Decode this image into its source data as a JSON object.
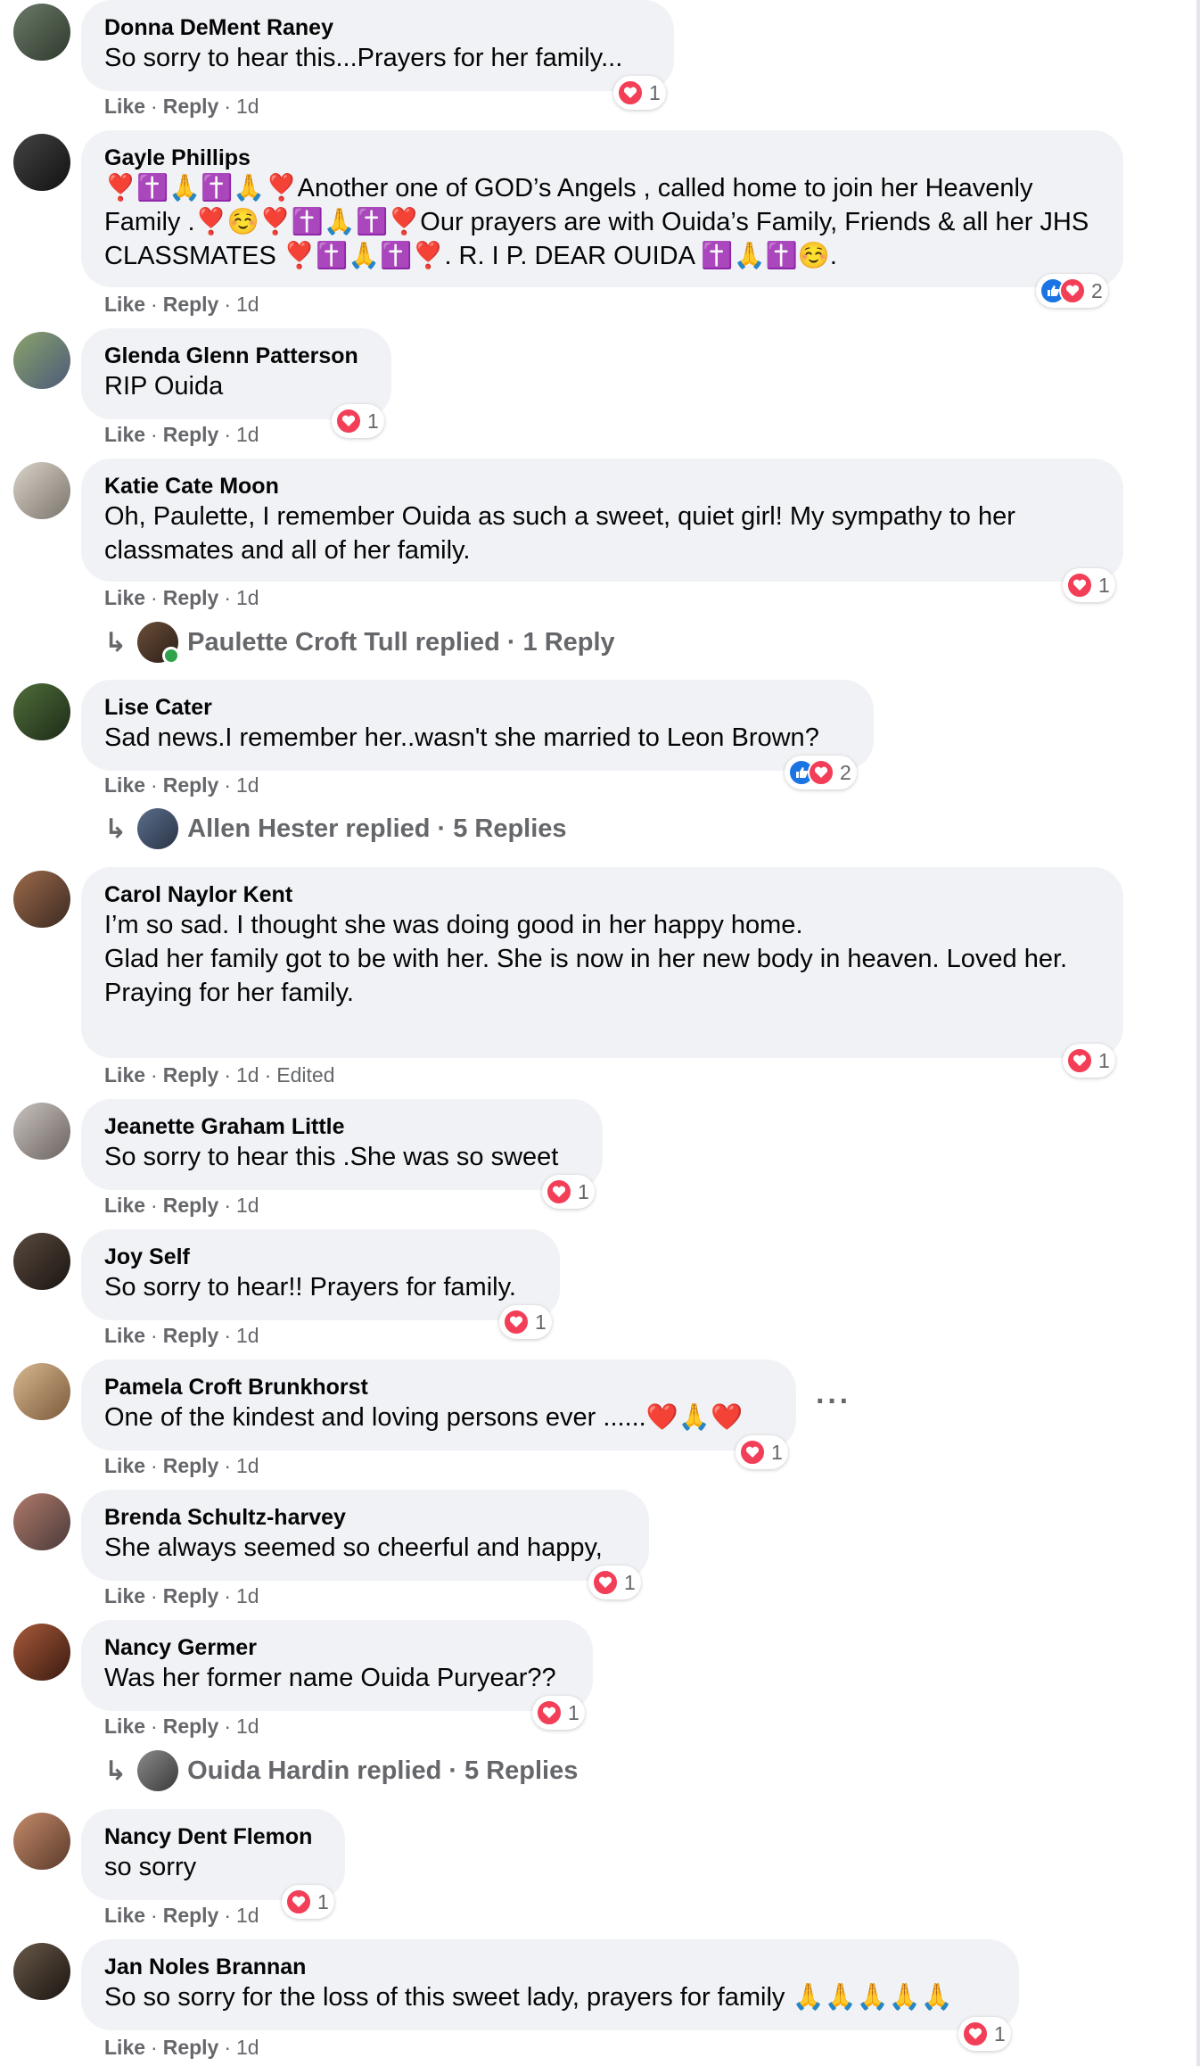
{
  "comments": [
    {
      "author": "Donna DeMent Raney",
      "text": "So sorry to hear this...Prayers for her family...",
      "like": "Like",
      "reply": "Reply",
      "time": "1d",
      "edited": "",
      "reactions": "1"
    },
    {
      "author": "Gayle Phillips",
      "text": "❣️✝️🙏✝️🙏❣️Another one of GOD’s Angels , called home to join her Heavenly Family .❣️☺️❣️✝️🙏✝️❣️Our prayers are with Ouida’s Family, Friends & all her JHS CLASSMATES ❣️✝️🙏✝️❣️. R. I P. DEAR OUIDA ✝️🙏✝️☺️.",
      "like": "Like",
      "reply": "Reply",
      "time": "1d",
      "edited": "",
      "reactions": "2"
    },
    {
      "author": "Glenda Glenn Patterson",
      "text": "RIP Ouida",
      "like": "Like",
      "reply": "Reply",
      "time": "1d",
      "edited": "",
      "reactions": "1"
    },
    {
      "author": "Katie Cate Moon",
      "text": "Oh, Paulette, I remember Ouida as such a sweet, quiet girl! My sympathy to her classmates and all of her family.",
      "like": "Like",
      "reply": "Reply",
      "time": "1d",
      "edited": "",
      "reactions": "1",
      "replied_by": "Paulette Croft Tull replied",
      "reply_count": "1 Reply"
    },
    {
      "author": "Lise Cater",
      "text": "Sad news.I remember her..wasn't she married to Leon Brown?",
      "like": "Like",
      "reply": "Reply",
      "time": "1d",
      "edited": "",
      "reactions": "2",
      "replied_by": "Allen Hester replied",
      "reply_count": "5 Replies"
    },
    {
      "author": "Carol Naylor Kent",
      "text": "I’m so sad. I thought she was doing good in her happy home.\nGlad her family got to be with her. She is now in her new body in heaven. Loved her.\nPraying for her family.",
      "like": "Like",
      "reply": "Reply",
      "time": "1d",
      "edited": "Edited",
      "reactions": "1"
    },
    {
      "author": "Jeanette Graham Little",
      "text": "So sorry to hear this .She was so sweet",
      "like": "Like",
      "reply": "Reply",
      "time": "1d",
      "edited": "",
      "reactions": "1"
    },
    {
      "author": "Joy Self",
      "text": "So sorry to hear!! Prayers for family.",
      "like": "Like",
      "reply": "Reply",
      "time": "1d",
      "edited": "",
      "reactions": "1"
    },
    {
      "author": "Pamela Croft Brunkhorst",
      "text": "One of the kindest and loving persons ever ......❤️🙏❤️",
      "like": "Like",
      "reply": "Reply",
      "time": "1d",
      "edited": "",
      "reactions": "1",
      "more": "···"
    },
    {
      "author": "Brenda Schultz-harvey",
      "text": "She always seemed so cheerful and happy,",
      "like": "Like",
      "reply": "Reply",
      "time": "1d",
      "edited": "",
      "reactions": "1"
    },
    {
      "author": "Nancy Germer",
      "text": "Was her former name Ouida Puryear??",
      "like": "Like",
      "reply": "Reply",
      "time": "1d",
      "edited": "",
      "reactions": "1",
      "replied_by": "Ouida Hardin replied",
      "reply_count": "5 Replies"
    },
    {
      "author": "Nancy Dent Flemon",
      "text": "so sorry",
      "like": "Like",
      "reply": "Reply",
      "time": "1d",
      "edited": "",
      "reactions": "1"
    },
    {
      "author": "Jan Noles Brannan",
      "text": "So so sorry for the loss of this sweet lady, prayers for family 🙏🙏🙏🙏🙏",
      "like": "Like",
      "reply": "Reply",
      "time": "1d",
      "edited": "",
      "reactions": "1"
    }
  ],
  "colors": {
    "bubble": "#f0f2f5",
    "meta": "#65676b",
    "heart": "#f33e58",
    "like": "#1b74e4"
  }
}
